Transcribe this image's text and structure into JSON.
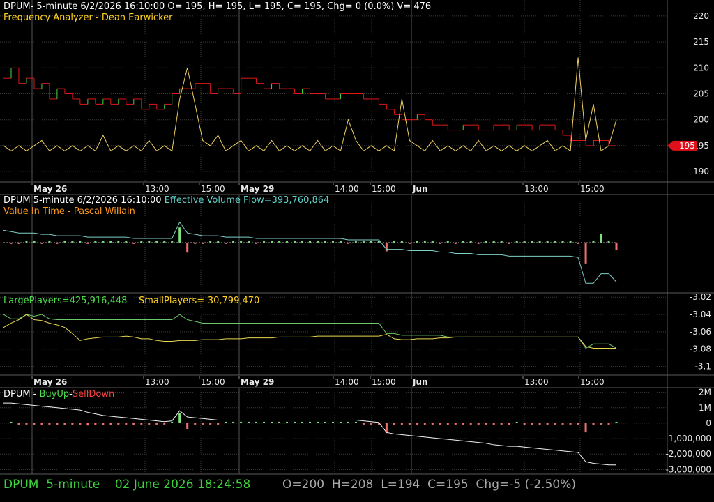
{
  "panel1": {
    "header": "DPUM- 5-minute 6/2/2026 16:10:00 O= 195, H= 195, L= 195, C= 195, Chg= 0 (0.0%) V= 476",
    "indicator": "Frequency Analyzer - Dean Earwicker",
    "price_marker": "195"
  },
  "panel2": {
    "header_prefix": "DPUM 5-minute  6/2/2026 16:10:00",
    "header_value": "Effective Volume Flow=393,760,864",
    "indicator": "Value In Time - Pascal Willain"
  },
  "panel3": {
    "large_players": "LargePlayers=425,916,448",
    "small_players": "SmallPlayers=-30,799,470"
  },
  "panel4": {
    "prefix": "DPUM - ",
    "buy_up": "BuyUp",
    "separator": "-",
    "sell_down": "SellDown"
  },
  "status": {
    "symbol": "DPUM",
    "interval": "5-minute",
    "datetime": "02 June 2026 18:24:58",
    "open": "O=200",
    "high": "H=208",
    "low": "L=194",
    "close": "C=195",
    "change": "Chg=-5 (-2.50%)"
  },
  "colors": {
    "background": "#000000",
    "grid": "#3c3c3c",
    "price_red": "#e01818",
    "price_green": "#40d840",
    "frequency": "#f0d060",
    "flow": "#7fcfc8",
    "large_players": "#6cc86c",
    "small_players": "#e8d850",
    "bar_green": "#7ee27e",
    "bar_red": "#f07070"
  },
  "chart_data": [
    {
      "type": "line",
      "title": "DPUM 5-minute",
      "x_ticks": [
        "May 26",
        "13:00",
        "15:00",
        "May 29",
        "14:00",
        "15:00",
        "Jun",
        "13:00",
        "15:00"
      ],
      "y_ticks": [
        190,
        195,
        200,
        205,
        210,
        215,
        220
      ],
      "ylim": [
        188,
        222
      ],
      "series": [
        {
          "name": "Price",
          "values": [
            208,
            210,
            207,
            208,
            206,
            207,
            204,
            206,
            205,
            204,
            203,
            204,
            203,
            204,
            203,
            204,
            203,
            204,
            202,
            203,
            202,
            203,
            205,
            206,
            206,
            207,
            207,
            205,
            206,
            206,
            205,
            208,
            208,
            207,
            206,
            207,
            206,
            206,
            205,
            206,
            205,
            205,
            204,
            204,
            205,
            205,
            205,
            204,
            204,
            203,
            202,
            201,
            200,
            200,
            201,
            200,
            199,
            199,
            198,
            198,
            199,
            199,
            198,
            198,
            199,
            199,
            198,
            199,
            199,
            198,
            199,
            199,
            198,
            197,
            196,
            196,
            195,
            196,
            196,
            195,
            195
          ]
        },
        {
          "name": "Frequency Analyzer",
          "values": [
            195,
            194,
            195,
            194,
            195,
            196,
            194,
            195,
            194,
            195,
            194,
            195,
            194,
            197,
            194,
            195,
            194,
            195,
            194,
            196,
            194,
            195,
            194,
            204,
            210,
            203,
            196,
            195,
            197,
            194,
            195,
            196,
            194,
            195,
            194,
            196,
            194,
            195,
            194,
            195,
            194,
            196,
            194,
            195,
            194,
            200,
            196,
            194,
            195,
            194,
            195,
            194,
            204,
            196,
            195,
            194,
            196,
            194,
            195,
            194,
            195,
            194,
            196,
            194,
            195,
            194,
            195,
            194,
            195,
            194,
            195,
            196,
            194,
            195,
            194,
            212,
            196,
            203,
            194,
            195,
            200
          ]
        }
      ]
    },
    {
      "type": "line",
      "title": "Effective Volume Flow",
      "series": [
        {
          "name": "Effective Volume Flow",
          "values": [
            0.9,
            0.8,
            0.7,
            0.7,
            0.7,
            0.6,
            0.6,
            0.5,
            0.5,
            0.5,
            0.5,
            0.4,
            0.4,
            0.4,
            0.4,
            0.4,
            0.4,
            0.3,
            0.3,
            0.3,
            0.3,
            0.3,
            0.3,
            1.5,
            0.7,
            0.6,
            0.5,
            0.5,
            0.5,
            0.4,
            0.4,
            0.4,
            0.4,
            0.3,
            0.3,
            0.3,
            0.3,
            0.3,
            0.3,
            0.3,
            0.3,
            0.3,
            0.3,
            0.3,
            0.3,
            0.2,
            0.2,
            0.2,
            0.2,
            0.2,
            -0.5,
            -0.5,
            -0.5,
            -0.6,
            -0.6,
            -0.6,
            -0.6,
            -0.7,
            -0.7,
            -0.8,
            -0.8,
            -0.8,
            -0.9,
            -0.9,
            -0.9,
            -0.9,
            -1.0,
            -1.0,
            -1.0,
            -1.0,
            -1.0,
            -1.0,
            -1.0,
            -1.0,
            -1.0,
            -1.1,
            -3.0,
            -3.0,
            -2.3,
            -2.3,
            -2.9
          ]
        }
      ]
    },
    {
      "type": "line",
      "title": "LargePlayers / SmallPlayers",
      "y_ticks": [
        -3.02,
        -3.04,
        -3.06,
        -3.08,
        -3.1
      ],
      "ylim": [
        -3.11,
        -3.015
      ],
      "series": [
        {
          "name": "LargePlayers",
          "values": [
            -3.04,
            -3.045,
            -3.045,
            -3.04,
            -3.042,
            -3.04,
            -3.045,
            -3.046,
            -3.046,
            -3.046,
            -3.046,
            -3.046,
            -3.046,
            -3.046,
            -3.046,
            -3.046,
            -3.046,
            -3.046,
            -3.046,
            -3.046,
            -3.046,
            -3.046,
            -3.046,
            -3.04,
            -3.046,
            -3.048,
            -3.05,
            -3.05,
            -3.05,
            -3.05,
            -3.05,
            -3.05,
            -3.05,
            -3.05,
            -3.05,
            -3.05,
            -3.05,
            -3.05,
            -3.05,
            -3.05,
            -3.05,
            -3.05,
            -3.05,
            -3.05,
            -3.05,
            -3.05,
            -3.05,
            -3.05,
            -3.05,
            -3.05,
            -3.062,
            -3.062,
            -3.064,
            -3.064,
            -3.064,
            -3.064,
            -3.064,
            -3.064,
            -3.066,
            -3.066,
            -3.066,
            -3.066,
            -3.066,
            -3.066,
            -3.066,
            -3.066,
            -3.066,
            -3.066,
            -3.066,
            -3.066,
            -3.066,
            -3.066,
            -3.066,
            -3.066,
            -3.066,
            -3.066,
            -3.079,
            -3.074,
            -3.074,
            -3.074,
            -3.079
          ]
        },
        {
          "name": "SmallPlayers",
          "values": [
            -3.055,
            -3.05,
            -3.046,
            -3.04,
            -3.046,
            -3.047,
            -3.05,
            -3.052,
            -3.055,
            -3.062,
            -3.07,
            -3.068,
            -3.067,
            -3.066,
            -3.066,
            -3.066,
            -3.065,
            -3.066,
            -3.068,
            -3.068,
            -3.07,
            -3.071,
            -3.071,
            -3.07,
            -3.07,
            -3.07,
            -3.069,
            -3.069,
            -3.069,
            -3.068,
            -3.068,
            -3.068,
            -3.067,
            -3.067,
            -3.067,
            -3.067,
            -3.066,
            -3.066,
            -3.066,
            -3.066,
            -3.066,
            -3.065,
            -3.065,
            -3.065,
            -3.065,
            -3.065,
            -3.065,
            -3.065,
            -3.065,
            -3.065,
            -3.063,
            -3.068,
            -3.069,
            -3.069,
            -3.068,
            -3.068,
            -3.068,
            -3.067,
            -3.067,
            -3.066,
            -3.066,
            -3.066,
            -3.066,
            -3.066,
            -3.066,
            -3.066,
            -3.066,
            -3.066,
            -3.066,
            -3.066,
            -3.066,
            -3.066,
            -3.066,
            -3.066,
            -3.066,
            -3.066,
            -3.077,
            -3.079,
            -3.079,
            -3.079,
            -3.079
          ]
        }
      ]
    },
    {
      "type": "line",
      "title": "BuyUp-SellDown",
      "y_ticks": [
        "2M",
        "1M",
        "0",
        "-1,000,000",
        "-2,000,000",
        "-3,000,000"
      ],
      "ylim": [
        -3300000,
        2300000
      ],
      "series": [
        {
          "name": "BuyUp-SellDown",
          "values": [
            1300000,
            1300000,
            1250000,
            1200000,
            1150000,
            1100000,
            1050000,
            1000000,
            950000,
            900000,
            850000,
            700000,
            600000,
            500000,
            450000,
            400000,
            350000,
            300000,
            250000,
            200000,
            150000,
            100000,
            150000,
            800000,
            400000,
            350000,
            300000,
            250000,
            200000,
            200000,
            200000,
            200000,
            200000,
            200000,
            200000,
            200000,
            200000,
            200000,
            200000,
            200000,
            200000,
            200000,
            200000,
            200000,
            200000,
            200000,
            200000,
            150000,
            100000,
            50000,
            -600000,
            -700000,
            -750000,
            -800000,
            -850000,
            -900000,
            -950000,
            -1000000,
            -1050000,
            -1100000,
            -1150000,
            -1200000,
            -1250000,
            -1300000,
            -1400000,
            -1450000,
            -1500000,
            -1500000,
            -1550000,
            -1600000,
            -1650000,
            -1700000,
            -1750000,
            -1800000,
            -1850000,
            -1900000,
            -2500000,
            -2600000,
            -2650000,
            -2700000,
            -2700000
          ]
        }
      ]
    }
  ]
}
